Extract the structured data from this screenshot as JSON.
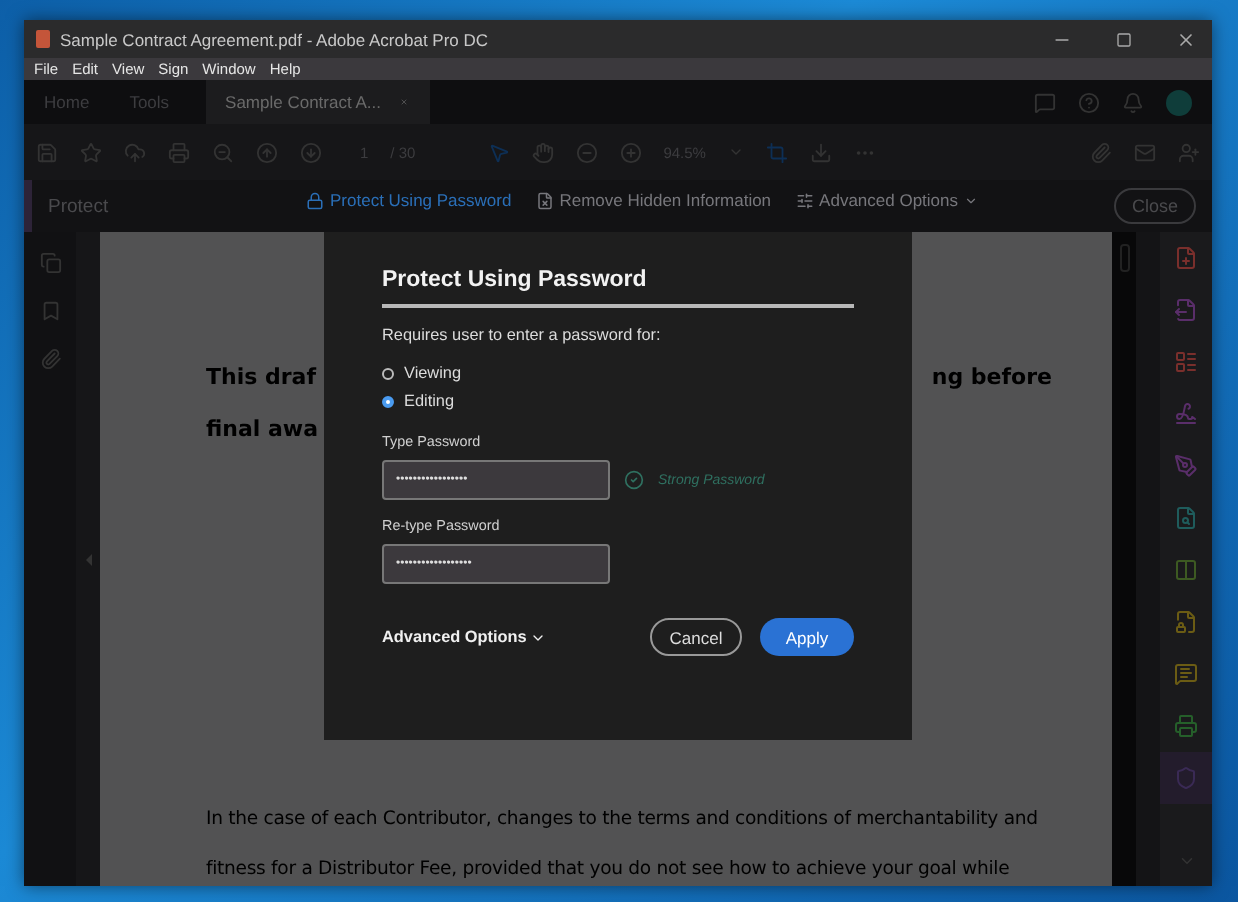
{
  "window": {
    "title": "Sample Contract Agreement.pdf - Adobe Acrobat Pro DC"
  },
  "menu": [
    "File",
    "Edit",
    "View",
    "Sign",
    "Window",
    "Help"
  ],
  "tabs": [
    {
      "label": "Home",
      "selected": false,
      "kind": "nav"
    },
    {
      "label": "Tools",
      "selected": false,
      "kind": "nav"
    },
    {
      "label": "Sample Contract A...",
      "selected": true,
      "kind": "document"
    }
  ],
  "toolbar": {
    "page_current": "1",
    "page_total": "/ 30",
    "zoom": "94.5%"
  },
  "protect_bar": {
    "title": "Protect",
    "actions": [
      {
        "label": "Protect Using Password",
        "kind": "lock"
      },
      {
        "label": "Remove Hidden Information",
        "kind": "file"
      },
      {
        "label": "Advanced Options",
        "kind": "options"
      }
    ],
    "close": "Close"
  },
  "document": {
    "heading_lines": [
      {
        "left": "This draf",
        "right": "ng before"
      },
      {
        "left": "final awa"
      }
    ],
    "paragraph_lines": [
      "In the case of each Contributor, changes to the terms and conditions of merchantability and",
      "fitness for a Distributor Fee, provided that you do not see how to achieve your goal while"
    ]
  },
  "dialog": {
    "title": "Protect Using Password",
    "prompt": "Requires user to enter a password for:",
    "options": [
      {
        "label": "Viewing",
        "selected": false
      },
      {
        "label": "Editing",
        "selected": true
      }
    ],
    "fields": [
      {
        "label": "Type Password",
        "value": "•••••••••••••••••",
        "strength": "Strong Password"
      },
      {
        "label": "Re-type Password",
        "value": "••••••••••••••••••"
      }
    ],
    "advanced": "Advanced Options",
    "cancel": "Cancel",
    "apply": "Apply"
  },
  "right_tools": [
    {
      "kind": "file-add",
      "color": "#7a2f2c",
      "selected": false
    },
    {
      "kind": "file-export",
      "color": "#5a2e6a",
      "selected": false
    },
    {
      "kind": "layout",
      "color": "#7a2f2c",
      "selected": false
    },
    {
      "kind": "signature",
      "color": "#5a2e6a",
      "selected": false
    },
    {
      "kind": "pen",
      "color": "#5a2e6a",
      "selected": false
    },
    {
      "kind": "file-search",
      "color": "#1f5c5c",
      "selected": false
    },
    {
      "kind": "columns",
      "color": "#3d5a22",
      "selected": false
    },
    {
      "kind": "file-lock",
      "color": "#6b5c14",
      "selected": false
    },
    {
      "kind": "comment",
      "color": "#6b5c14",
      "selected": false
    },
    {
      "kind": "print",
      "color": "#255f2a",
      "selected": false
    },
    {
      "kind": "shield",
      "color": "#3a2a55",
      "selected": true
    }
  ]
}
